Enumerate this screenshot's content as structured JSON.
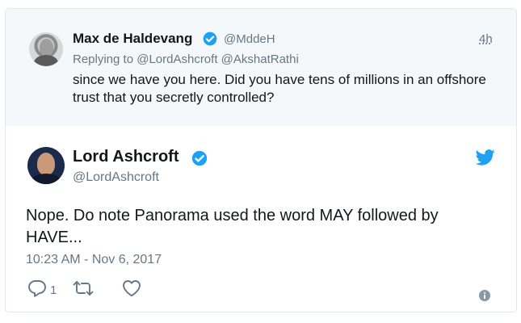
{
  "parent_tweet": {
    "name": "Max de Haldevang",
    "handle": "@MddeH",
    "time": "4h",
    "replying_label": "Replying to",
    "replying_to": [
      "@LordAshcroft",
      "@AkshatRathi"
    ],
    "text": "since we have you here. Did you have tens of millions in an offshore trust that you secretly controlled?"
  },
  "main_tweet": {
    "name": "Lord Ashcroft",
    "handle": "@LordAshcroft",
    "text": "Nope. Do note Panorama used the word MAY followed by HAVE...",
    "timestamp": "10:23 AM - Nov 6, 2017",
    "reply_count": "1"
  },
  "icons": {
    "verified": "verified-badge-icon",
    "brand": "twitter-bird-icon",
    "reply": "reply-icon",
    "retweet": "retweet-icon",
    "like": "heart-icon",
    "info": "info-icon"
  },
  "colors": {
    "brand_blue": "#1da1f2",
    "secondary_text": "#657786",
    "primary_text": "#14171a",
    "parent_bg": "#f5f8fa"
  }
}
